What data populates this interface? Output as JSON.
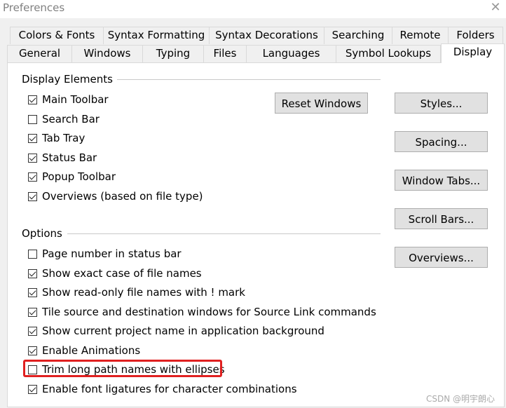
{
  "window": {
    "title": "Preferences",
    "close_glyph": "✕"
  },
  "tabs_row1": [
    "Colors & Fonts",
    "Syntax Formatting",
    "Syntax Decorations",
    "Searching",
    "Remote",
    "Folders"
  ],
  "tabs_row2": [
    "General",
    "Windows",
    "Typing",
    "Files",
    "Languages",
    "Symbol Lookups",
    "Display"
  ],
  "active_tab": "Display",
  "display_elements": {
    "title": "Display Elements",
    "items": [
      {
        "label": "Main Toolbar",
        "checked": true
      },
      {
        "label": "Search Bar",
        "checked": false
      },
      {
        "label": "Tab Tray",
        "checked": true
      },
      {
        "label": "Status Bar",
        "checked": true
      },
      {
        "label": "Popup Toolbar",
        "checked": true
      },
      {
        "label": "Overviews (based on file type)",
        "checked": true
      }
    ]
  },
  "options": {
    "title": "Options",
    "items": [
      {
        "label": "Page number in status bar",
        "checked": false
      },
      {
        "label": "Show exact case of file names",
        "checked": true
      },
      {
        "label": "Show read-only file names with ! mark",
        "checked": true
      },
      {
        "label": "Tile source and destination windows for Source Link commands",
        "checked": true
      },
      {
        "label": "Show current project name in application background",
        "checked": true
      },
      {
        "label": "Enable Animations",
        "checked": true
      },
      {
        "label": "Trim long path names with ellipses",
        "checked": false
      },
      {
        "label": "Enable font ligatures for character combinations",
        "checked": true
      }
    ]
  },
  "buttons": {
    "reset_windows": "Reset Windows",
    "styles": "Styles...",
    "spacing": "Spacing...",
    "window_tabs": "Window Tabs...",
    "scroll_bars": "Scroll Bars...",
    "overviews": "Overviews..."
  },
  "watermark": "CSDN @明宇朗心",
  "colors": {
    "highlight": "#e02020",
    "panel_bg": "#ffffff",
    "dialog_bg": "#f0f0f0"
  }
}
